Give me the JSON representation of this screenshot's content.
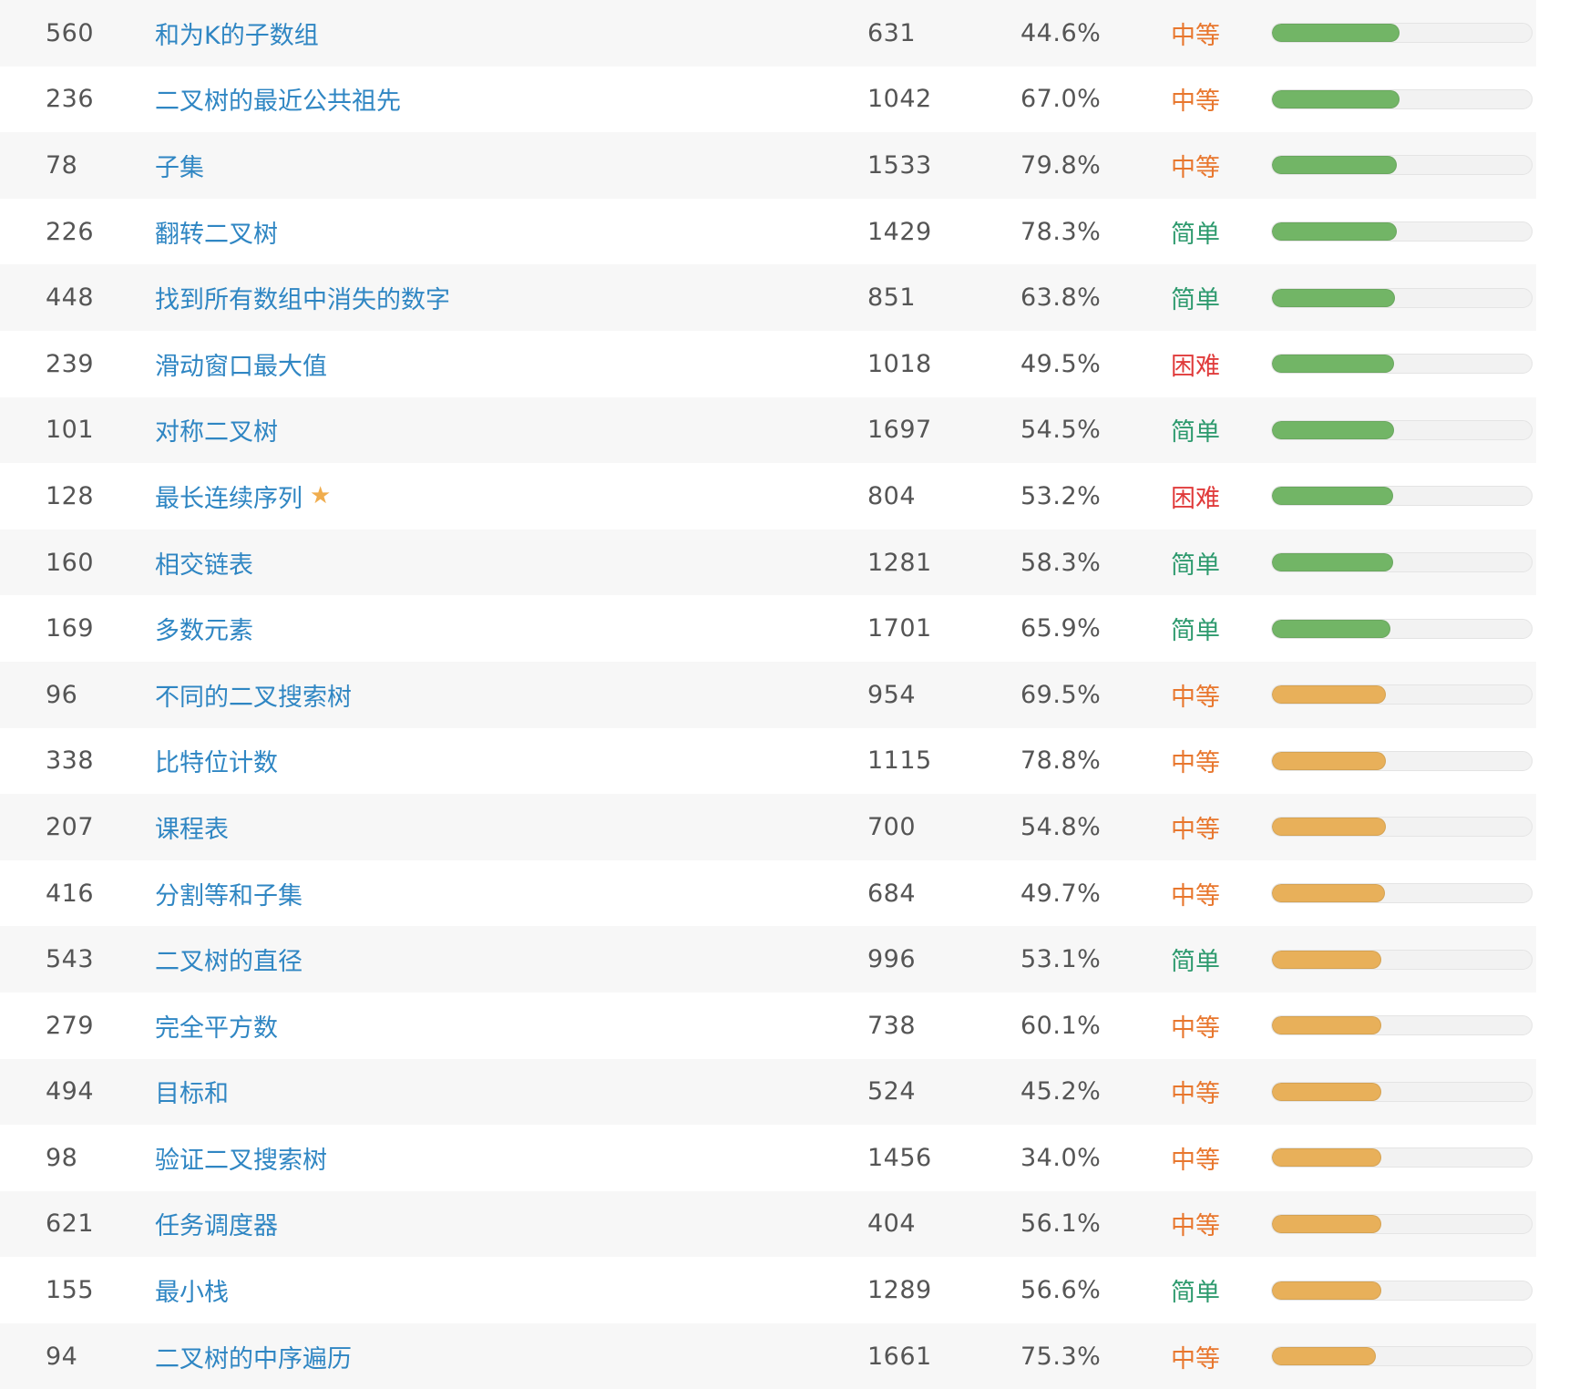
{
  "rows": [
    {
      "id": "560",
      "title": "和为K的子数组",
      "submissions": "631",
      "rate": "44.6%",
      "difficulty": "中等",
      "level": "mid",
      "frequency": 0.49,
      "bar_color": "green",
      "star": false
    },
    {
      "id": "236",
      "title": "二叉树的最近公共祖先",
      "submissions": "1042",
      "rate": "67.0%",
      "difficulty": "中等",
      "level": "mid",
      "frequency": 0.49,
      "bar_color": "green",
      "star": false
    },
    {
      "id": "78",
      "title": "子集",
      "submissions": "1533",
      "rate": "79.8%",
      "difficulty": "中等",
      "level": "mid",
      "frequency": 0.48,
      "bar_color": "green",
      "star": false
    },
    {
      "id": "226",
      "title": "翻转二叉树",
      "submissions": "1429",
      "rate": "78.3%",
      "difficulty": "简单",
      "level": "easy",
      "frequency": 0.48,
      "bar_color": "green",
      "star": false
    },
    {
      "id": "448",
      "title": "找到所有数组中消失的数字",
      "submissions": "851",
      "rate": "63.8%",
      "difficulty": "简单",
      "level": "easy",
      "frequency": 0.475,
      "bar_color": "green",
      "star": false
    },
    {
      "id": "239",
      "title": "滑动窗口最大值",
      "submissions": "1018",
      "rate": "49.5%",
      "difficulty": "困难",
      "level": "hard",
      "frequency": 0.47,
      "bar_color": "green",
      "star": false
    },
    {
      "id": "101",
      "title": "对称二叉树",
      "submissions": "1697",
      "rate": "54.5%",
      "difficulty": "简单",
      "level": "easy",
      "frequency": 0.47,
      "bar_color": "green",
      "star": false
    },
    {
      "id": "128",
      "title": "最长连续序列",
      "submissions": "804",
      "rate": "53.2%",
      "difficulty": "困难",
      "level": "hard",
      "frequency": 0.465,
      "bar_color": "green",
      "star": true
    },
    {
      "id": "160",
      "title": "相交链表",
      "submissions": "1281",
      "rate": "58.3%",
      "difficulty": "简单",
      "level": "easy",
      "frequency": 0.465,
      "bar_color": "green",
      "star": false
    },
    {
      "id": "169",
      "title": "多数元素",
      "submissions": "1701",
      "rate": "65.9%",
      "difficulty": "简单",
      "level": "easy",
      "frequency": 0.455,
      "bar_color": "green",
      "star": false
    },
    {
      "id": "96",
      "title": "不同的二叉搜索树",
      "submissions": "954",
      "rate": "69.5%",
      "difficulty": "中等",
      "level": "mid",
      "frequency": 0.44,
      "bar_color": "orange",
      "star": false
    },
    {
      "id": "338",
      "title": "比特位计数",
      "submissions": "1115",
      "rate": "78.8%",
      "difficulty": "中等",
      "level": "mid",
      "frequency": 0.44,
      "bar_color": "orange",
      "star": false
    },
    {
      "id": "207",
      "title": "课程表",
      "submissions": "700",
      "rate": "54.8%",
      "difficulty": "中等",
      "level": "mid",
      "frequency": 0.44,
      "bar_color": "orange",
      "star": false
    },
    {
      "id": "416",
      "title": "分割等和子集",
      "submissions": "684",
      "rate": "49.7%",
      "difficulty": "中等",
      "level": "mid",
      "frequency": 0.435,
      "bar_color": "orange",
      "star": false
    },
    {
      "id": "543",
      "title": "二叉树的直径",
      "submissions": "996",
      "rate": "53.1%",
      "difficulty": "简单",
      "level": "easy",
      "frequency": 0.42,
      "bar_color": "orange",
      "star": false
    },
    {
      "id": "279",
      "title": "完全平方数",
      "submissions": "738",
      "rate": "60.1%",
      "difficulty": "中等",
      "level": "mid",
      "frequency": 0.42,
      "bar_color": "orange",
      "star": false
    },
    {
      "id": "494",
      "title": "目标和",
      "submissions": "524",
      "rate": "45.2%",
      "difficulty": "中等",
      "level": "mid",
      "frequency": 0.42,
      "bar_color": "orange",
      "star": false
    },
    {
      "id": "98",
      "title": "验证二叉搜索树",
      "submissions": "1456",
      "rate": "34.0%",
      "difficulty": "中等",
      "level": "mid",
      "frequency": 0.42,
      "bar_color": "orange",
      "star": false
    },
    {
      "id": "621",
      "title": "任务调度器",
      "submissions": "404",
      "rate": "56.1%",
      "difficulty": "中等",
      "level": "mid",
      "frequency": 0.42,
      "bar_color": "orange",
      "star": false
    },
    {
      "id": "155",
      "title": "最小栈",
      "submissions": "1289",
      "rate": "56.6%",
      "difficulty": "简单",
      "level": "easy",
      "frequency": 0.42,
      "bar_color": "orange",
      "star": false
    },
    {
      "id": "94",
      "title": "二叉树的中序遍历",
      "submissions": "1661",
      "rate": "75.3%",
      "difficulty": "中等",
      "level": "mid",
      "frequency": 0.4,
      "bar_color": "orange",
      "star": false
    }
  ],
  "colors": {
    "link": "#2f86c3",
    "medium": "#e8772e",
    "easy": "#2e9a6e",
    "hard": "#e03b3b",
    "bar_green": "#72b566",
    "bar_orange": "#e8b05a",
    "star": "#f0ad4e"
  },
  "icons": {
    "favorite": "star-icon"
  }
}
